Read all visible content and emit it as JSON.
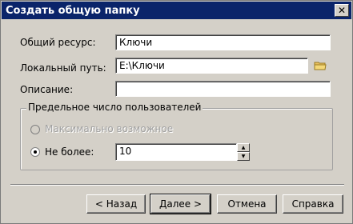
{
  "window": {
    "title": "Создать общую папку",
    "close_glyph": "✕"
  },
  "fields": {
    "share": {
      "label": "Общий ресурс:",
      "value": "Ключи"
    },
    "local_path": {
      "label": "Локальный путь:",
      "value": "E:\\Ключи",
      "browse_icon": "folder-icon"
    },
    "description": {
      "label": "Описание:",
      "value": ""
    }
  },
  "user_limit": {
    "group_label": "Предельное число пользователей",
    "max_allowed": {
      "label": "Максимально возможное",
      "selected": false,
      "enabled": false
    },
    "no_more_than": {
      "label": "Не более:",
      "selected": true,
      "value": "10"
    },
    "spin_up": "▲",
    "spin_down": "▼"
  },
  "buttons": {
    "back": "< Назад",
    "next": "Далее >",
    "cancel": "Отмена",
    "help": "Справка"
  }
}
